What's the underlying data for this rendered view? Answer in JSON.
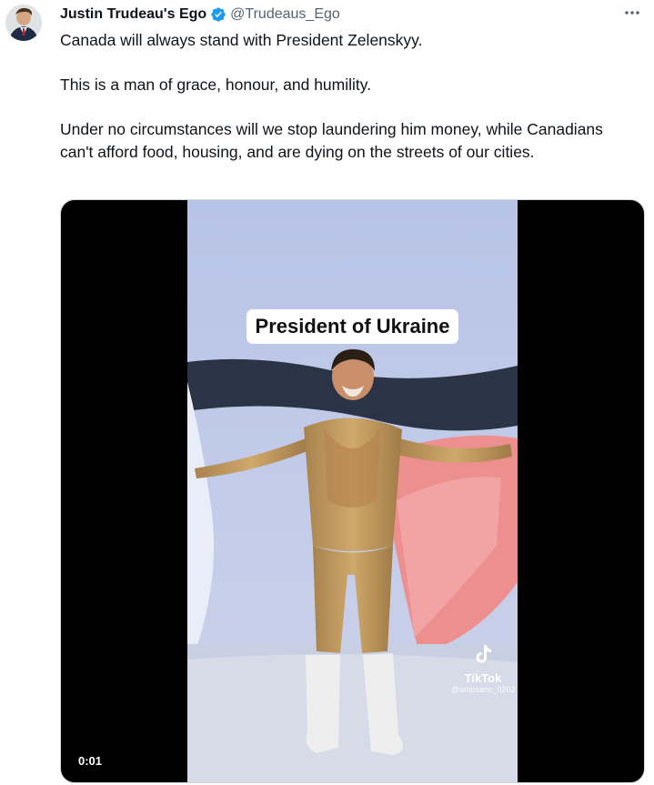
{
  "author": {
    "display_name": "Justin Trudeau's Ego",
    "handle": "@Trudeaus_Ego",
    "verified": true
  },
  "tweet": {
    "paragraphs": [
      "Canada will always stand with President Zelenskyy.",
      "This is a man of grace, honour, and humility.",
      "Under no circumstances will we stop laundering him money, while Canadians can't afford food, housing, and are dying on the streets of our cities."
    ]
  },
  "media": {
    "type": "video",
    "caption_overlay": "President of Ukraine",
    "watermark_label": "TikTok",
    "watermark_user": "@ambsanc_0202",
    "elapsed": "0:01"
  },
  "icons": {
    "verified": "verified-badge-icon",
    "more": "more-options-icon",
    "watermark": "tiktok-logo-icon"
  },
  "colors": {
    "verified_blue": "#1d9bf0",
    "secondary_text": "#536471",
    "primary_text": "#0f1419"
  }
}
